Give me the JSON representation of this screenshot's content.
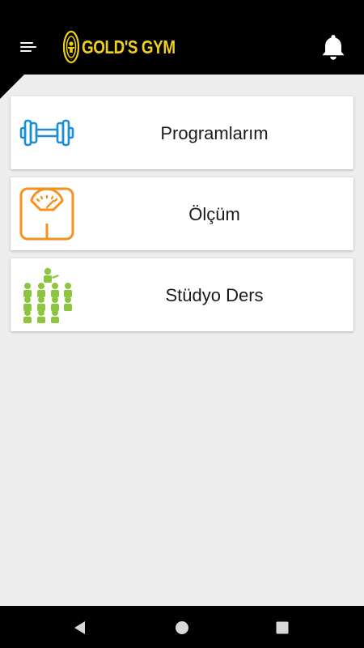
{
  "app": {
    "logo_text": "GOLD'S GYM",
    "brand_color": "#f1cf1f"
  },
  "header": {
    "menu_icon": "hamburger-menu-icon",
    "notification_icon": "bell-icon"
  },
  "menu": {
    "items": [
      {
        "label": "Programlarım",
        "icon": "dumbbell-icon",
        "color": "#1a8fd8"
      },
      {
        "label": "Ölçüm",
        "icon": "scale-icon",
        "color": "#f5921e"
      },
      {
        "label": "Stüdyo Ders",
        "icon": "studio-class-icon",
        "color": "#8cc63f"
      }
    ]
  },
  "navigation": {
    "back_icon": "back-triangle-icon",
    "home_icon": "home-circle-icon",
    "recents_icon": "recents-square-icon"
  }
}
